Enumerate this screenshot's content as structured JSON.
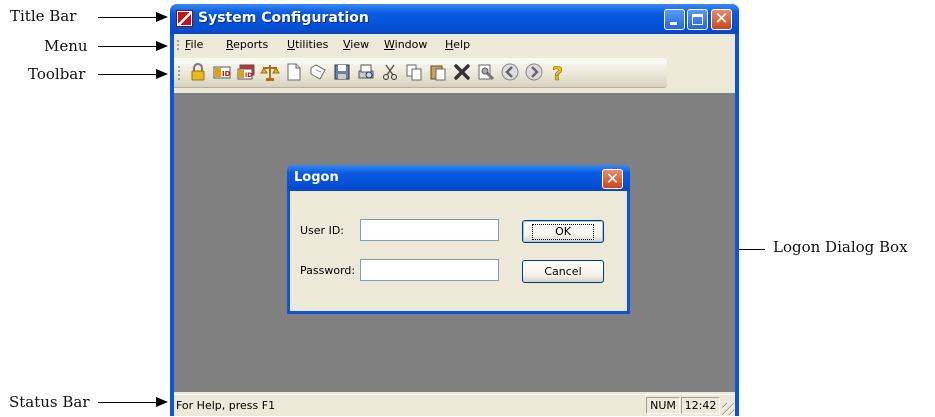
{
  "callouts": {
    "title_bar": "Title Bar",
    "menu": "Menu",
    "toolbar": "Toolbar",
    "status_bar": "Status Bar",
    "logon_dialog": "Logon Dialog Box"
  },
  "window": {
    "title": "System Configuration",
    "controls": [
      "minimize-icon",
      "maximize-icon",
      "close-icon"
    ]
  },
  "menu": {
    "items": [
      {
        "label_first": "F",
        "label_rest": "ile"
      },
      {
        "label_first": "R",
        "label_rest": "eports"
      },
      {
        "label_first": "U",
        "label_rest": "tilities"
      },
      {
        "label_first": "V",
        "label_rest": "iew"
      },
      {
        "label_first": "W",
        "label_rest": "indow"
      },
      {
        "label_first": "H",
        "label_rest": "elp"
      }
    ]
  },
  "toolbar": {
    "icons": [
      "lock-icon",
      "id-card-icon",
      "id-card-stack-icon",
      "scales-icon",
      "new-document-icon",
      "open-icon",
      "save-icon",
      "print-preview-icon",
      "cut-icon",
      "copy-icon",
      "paste-icon",
      "delete-icon",
      "properties-icon",
      "back-icon",
      "forward-icon",
      "help-icon"
    ]
  },
  "dialog": {
    "title": "Logon",
    "user_id_label": "User ID:",
    "password_label": "Password:",
    "user_id_value": "",
    "password_value": "",
    "ok_label": "OK",
    "cancel_label": "Cancel"
  },
  "status": {
    "message": "For Help, press F1",
    "num": "NUM",
    "time": "12:42"
  },
  "colors": {
    "title_blue": "#0a54e0",
    "workspace_gray": "#808080",
    "face": "#ece9d8"
  }
}
